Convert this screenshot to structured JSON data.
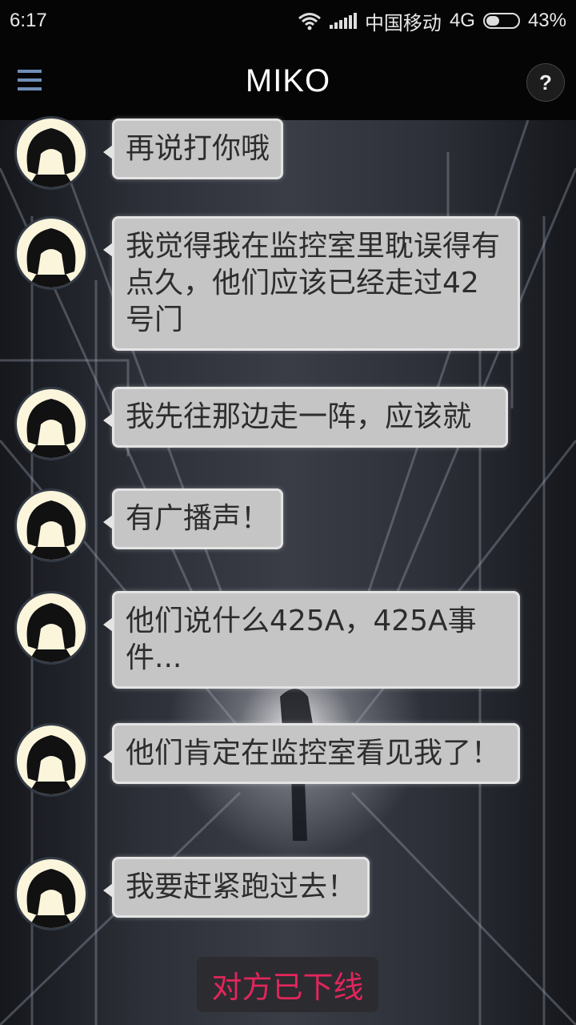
{
  "status_bar": {
    "time": "6:17",
    "carrier": "中国移动",
    "network": "4G",
    "battery": "43%",
    "battery_level": 0.43
  },
  "app_bar": {
    "title": "MIKO",
    "menu_icon": "hamburger-menu-icon",
    "help_icon": "question-mark-icon",
    "help_label": "?"
  },
  "messages": [
    {
      "sender": "miko",
      "text": "再说打你哦"
    },
    {
      "sender": "miko",
      "text": "我觉得我在监控室里耽误得有点久，他们应该已经走过42号门"
    },
    {
      "sender": "miko",
      "text": "我先往那边走一阵，应该就"
    },
    {
      "sender": "miko",
      "text": "有广播声！"
    },
    {
      "sender": "miko",
      "text": "他们说什么425A，425A事件..."
    },
    {
      "sender": "miko",
      "text": "他们肯定在监控室看见我了！"
    },
    {
      "sender": "miko",
      "text": "我要赶紧跑过去！"
    }
  ],
  "status_notice": "对方已下线",
  "colors": {
    "bubble": "#c5c5c5",
    "bubble_border": "#e4e4e4",
    "offline_text": "#e0265b",
    "menu_icon": "#6f8fb8",
    "avatar_bg": "#fbf5dc"
  }
}
